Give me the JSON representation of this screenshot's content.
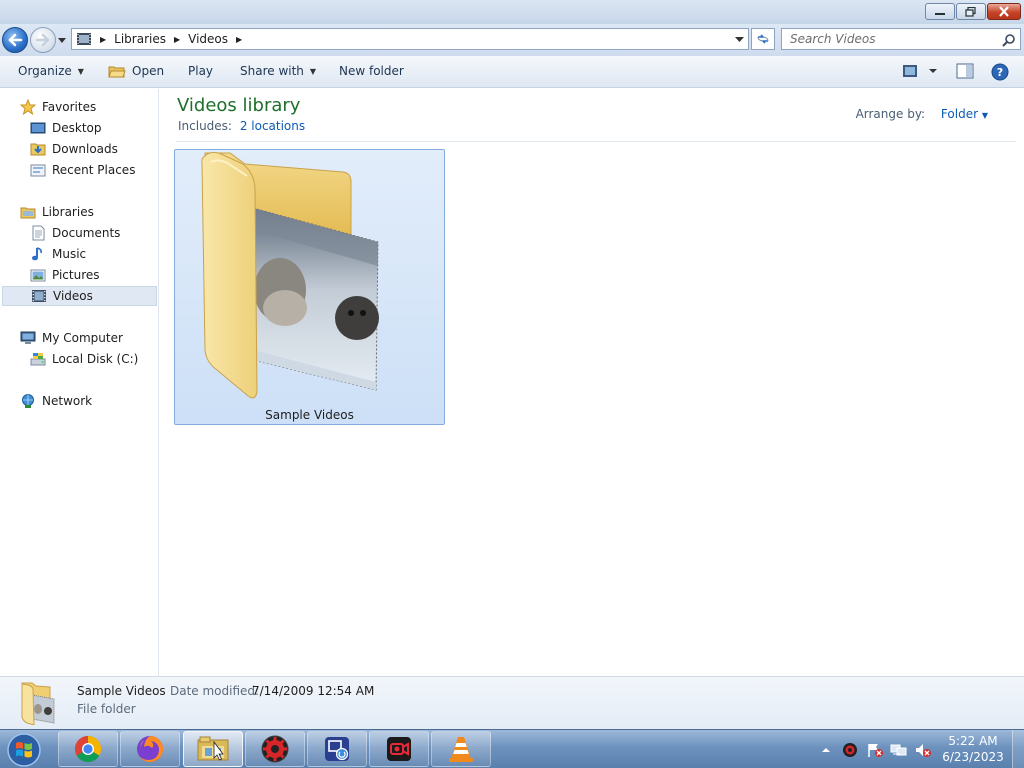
{
  "window": {
    "controls": [
      "minimize",
      "maximize",
      "close"
    ]
  },
  "address": {
    "breadcrumbs": [
      "Libraries",
      "Videos"
    ],
    "search_placeholder": "Search Videos"
  },
  "toolbar": {
    "organize": "Organize",
    "open": "Open",
    "play": "Play",
    "share_with": "Share with",
    "new_folder": "New folder"
  },
  "nav": {
    "favorites": "Favorites",
    "desktop": "Desktop",
    "downloads": "Downloads",
    "recent_places": "Recent Places",
    "libraries": "Libraries",
    "documents": "Documents",
    "music": "Music",
    "pictures": "Pictures",
    "videos": "Videos",
    "my_computer": "My Computer",
    "local_disk": "Local Disk (C:)",
    "network": "Network",
    "selected": "Videos"
  },
  "content": {
    "title": "Videos library",
    "includes_label": "Includes:",
    "includes_link": "2 locations",
    "arrange_label": "Arrange by:",
    "arrange_value": "Folder",
    "items": [
      {
        "name": "Sample Videos"
      }
    ]
  },
  "details": {
    "name": "Sample Videos",
    "date_label": "Date modified:",
    "date_value": "7/14/2009 12:54 AM",
    "type": "File folder"
  },
  "taskbar": {
    "apps": [
      "chrome",
      "firefox",
      "windows-explorer",
      "app-red-gear",
      "app-screen-recorder",
      "app-camera-recorder",
      "vlc"
    ],
    "active_app": "windows-explorer",
    "time": "5:22 AM",
    "date": "6/23/2023"
  },
  "colors": {
    "library_title": "#1e6f2b",
    "link": "#0d5bb5",
    "selection": "#cde0f7",
    "taskbar": "#6d92be"
  }
}
